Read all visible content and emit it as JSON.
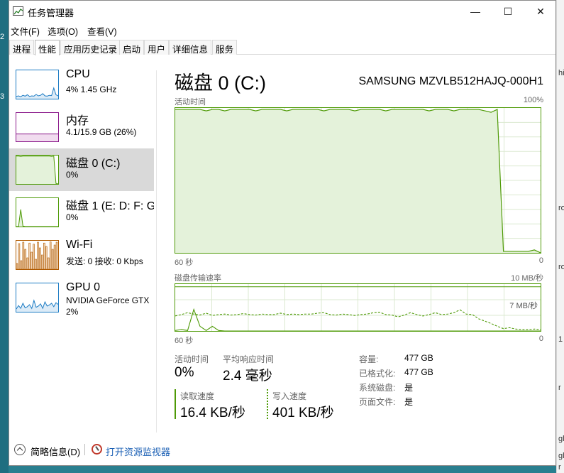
{
  "desktop": {
    "edge_marks": [
      "2",
      "3"
    ],
    "right_edge_marks": [
      "hi",
      "ro",
      "ro",
      "1",
      "r",
      "gl",
      "gl",
      "r"
    ]
  },
  "window": {
    "title": "任务管理器",
    "buttons": {
      "minimize": "—",
      "maximize": "☐",
      "close": "✕"
    }
  },
  "menu": [
    "文件(F)",
    "选项(O)",
    "查看(V)"
  ],
  "tabs": [
    {
      "label": "进程",
      "active": false
    },
    {
      "label": "性能",
      "active": true
    },
    {
      "label": "应用历史记录",
      "active": false
    },
    {
      "label": "启动",
      "active": false
    },
    {
      "label": "用户",
      "active": false
    },
    {
      "label": "详细信息",
      "active": false
    },
    {
      "label": "服务",
      "active": false
    }
  ],
  "sidebar": {
    "items": [
      {
        "name": "CPU",
        "sub": "4% 1.45 GHz",
        "sub2": "",
        "color": "#1d7cc4",
        "selected": false
      },
      {
        "name": "内存",
        "sub": "4.1/15.9 GB (26%)",
        "sub2": "",
        "color": "#8b1a8b",
        "selected": false
      },
      {
        "name": "磁盘 0 (C:)",
        "sub": "0%",
        "sub2": "",
        "color": "#4e9a06",
        "selected": true
      },
      {
        "name": "磁盘 1 (E: D: F: G:)",
        "sub": "0%",
        "sub2": "",
        "color": "#4e9a06",
        "selected": false
      },
      {
        "name": "Wi-Fi",
        "sub": "发送: 0 接收: 0 Kbps",
        "sub2": "",
        "color": "#b05a00",
        "selected": false
      },
      {
        "name": "GPU 0",
        "sub": "NVIDIA GeForce GTX",
        "sub2": "2%",
        "color": "#1d7cc4",
        "selected": false
      }
    ],
    "thumbnails": {
      "cpu": [
        8,
        10,
        7,
        12,
        9,
        14,
        8,
        10,
        9,
        15,
        10,
        12,
        18,
        10,
        9,
        12,
        11,
        38,
        14,
        10
      ],
      "memory": [
        26,
        26,
        26,
        26,
        26,
        26,
        26,
        26,
        26,
        26,
        26,
        26,
        26,
        26,
        26,
        26,
        26,
        26,
        26,
        26
      ],
      "disk0": [
        98,
        98,
        97,
        98,
        98,
        98,
        98,
        98,
        98,
        98,
        98,
        98,
        98,
        98,
        98,
        98,
        97,
        98,
        2,
        0
      ],
      "disk1": [
        0,
        0,
        60,
        2,
        0,
        0,
        0,
        0,
        0,
        0,
        0,
        0,
        0,
        0,
        0,
        0,
        0,
        0,
        0,
        0
      ],
      "wifi": [
        20,
        90,
        30,
        95,
        70,
        40,
        92,
        60,
        88,
        35,
        95,
        75,
        50,
        92,
        80,
        40,
        96,
        70,
        85,
        95
      ],
      "gpu": [
        10,
        22,
        12,
        30,
        14,
        18,
        25,
        12,
        40,
        16,
        20,
        28,
        12,
        35,
        20,
        24,
        30,
        18,
        32,
        26
      ]
    }
  },
  "main": {
    "title": "磁盘 0 (C:)",
    "model": "SAMSUNG MZVLB512HAJQ-000H1",
    "active_time_label": "活动时间",
    "active_time_max": "100%",
    "axis_left": "60 秒",
    "axis_right": "0",
    "transfer_label": "磁盘传输速率",
    "transfer_max": "10 MB/秒",
    "transfer_mid": "7 MB/秒",
    "axis_left2": "60 秒",
    "axis_right2": "0"
  },
  "chart_data": [
    {
      "type": "area",
      "title": "活动时间",
      "x_range": [
        60,
        0
      ],
      "ylim": [
        0,
        100
      ],
      "grid": true,
      "series": [
        {
          "values": [
            99,
            99,
            99,
            99,
            99,
            98,
            99,
            99,
            98,
            99,
            99,
            99,
            99,
            98,
            99,
            99,
            99,
            99,
            98,
            99,
            99,
            99,
            99,
            99,
            98,
            99,
            99,
            99,
            99,
            98,
            99,
            99,
            99,
            99,
            98,
            99,
            99,
            99,
            99,
            99,
            99,
            98,
            99,
            99,
            99,
            98,
            99,
            99,
            99,
            99,
            98,
            97,
            99,
            1,
            1,
            1,
            1,
            1,
            2,
            0
          ]
        }
      ]
    },
    {
      "type": "line",
      "title": "磁盘传输速率",
      "x_range": [
        60,
        0
      ],
      "ylim": [
        0,
        10
      ],
      "grid": true,
      "series": [
        {
          "style": "solid",
          "values": [
            0.1,
            0.3,
            0.1,
            4.6,
            1.0,
            0.1,
            1.0,
            0.1,
            0.0,
            0.0,
            0.0,
            0.0,
            0.0,
            0.0,
            0.0,
            0.0,
            0.0,
            0.0,
            0.0,
            0.0,
            0.0,
            0.0,
            0.0,
            0.0,
            0.0,
            0.0,
            0.0,
            0.0,
            0.0,
            0.0,
            0.0,
            0.0,
            0.0,
            0.0,
            0.0,
            0.0,
            0.0,
            0.0,
            0.0,
            0.0,
            0.0,
            0.0,
            0.0,
            0.0,
            0.0,
            0.0,
            0.0,
            0.0,
            0.0,
            0.0,
            0.0,
            0.0,
            0.0,
            0.0,
            0.0,
            0.0,
            0.0,
            0.0,
            0.0,
            0.0
          ]
        },
        {
          "style": "dashed",
          "values": [
            3.2,
            3.5,
            3.9,
            3.6,
            3.4,
            3.8,
            3.3,
            3.5,
            3.6,
            3.4,
            3.5,
            3.7,
            3.5,
            3.4,
            3.6,
            3.5,
            3.5,
            3.8,
            3.5,
            3.6,
            3.5,
            3.6,
            3.6,
            3.8,
            3.9,
            3.5,
            3.4,
            3.6,
            3.5,
            3.3,
            3.5,
            3.6,
            3.9,
            4.0,
            3.5,
            3.4,
            3.0,
            3.4,
            3.9,
            3.5,
            3.2,
            3.5,
            3.9,
            3.5,
            3.6,
            3.9,
            4.5,
            3.6,
            3.5,
            2.6,
            2.1,
            1.6,
            1.0,
            0.5,
            0.7,
            0.4,
            0.3,
            0.3,
            0.4,
            0.3
          ]
        }
      ]
    }
  ],
  "stats": {
    "active_time_label": "活动时间",
    "active_time_value": "0%",
    "response_label": "平均响应时间",
    "response_value": "2.4 毫秒",
    "read_label": "读取速度",
    "read_value": "16.4 KB/秒",
    "write_label": "写入速度",
    "write_value": "401 KB/秒"
  },
  "info": [
    {
      "key": "容量:",
      "value": "477 GB"
    },
    {
      "key": "已格式化:",
      "value": "477 GB"
    },
    {
      "key": "系统磁盘:",
      "value": "是"
    },
    {
      "key": "页面文件:",
      "value": "是"
    }
  ],
  "footer": {
    "fewer_details": "简略信息(D)",
    "open_monitor": "打开资源监视器"
  }
}
